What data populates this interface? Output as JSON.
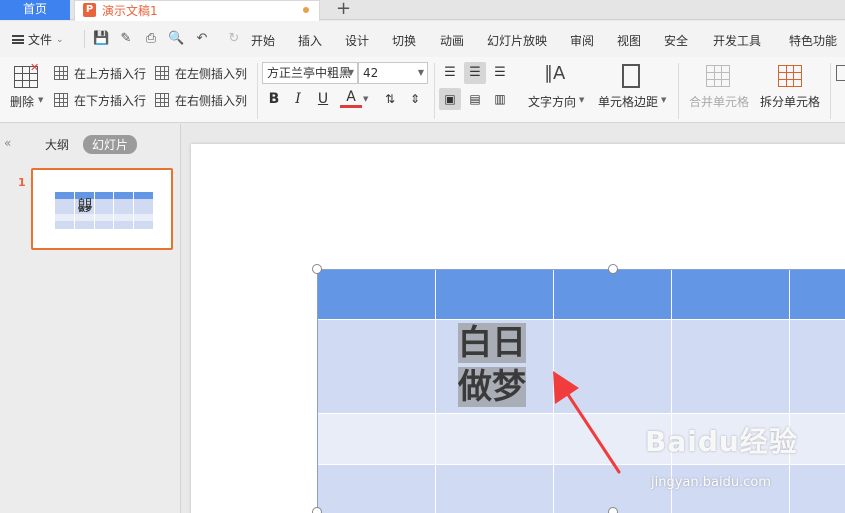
{
  "tabs": {
    "home_label": "首页",
    "doc_title": "演示文稿1",
    "doc_icon": "P",
    "add_label": "+"
  },
  "menu": {
    "file_label": "文件",
    "items": [
      "开始",
      "插入",
      "设计",
      "切换",
      "动画",
      "幻灯片放映",
      "审阅",
      "视图",
      "安全",
      "开发工具",
      "特色功能"
    ]
  },
  "ribbon": {
    "delete_label": "删除",
    "insert_above": "在上方插入行",
    "insert_below": "在下方插入行",
    "insert_left": "在左侧插入列",
    "insert_right": "在右侧插入列",
    "font_name": "方正兰亭中粗黑",
    "font_size": "42",
    "text_direction": "文字方向",
    "cell_margin": "单元格边距",
    "merge_cells": "合并单元格",
    "split_cells": "拆分单元格",
    "bold": "B",
    "italic": "I",
    "underline": "U",
    "font_color": "A"
  },
  "leftpanel": {
    "outline_tab": "大纲",
    "slides_tab": "幻灯片",
    "slide_number": "1",
    "thumb_text": "白日做梦"
  },
  "slide": {
    "cell_text_line1": "白日",
    "cell_text_line2": "做梦"
  },
  "watermark": {
    "brand": "Baidu经验",
    "url": "jingyan.baidu.com"
  },
  "colors": {
    "accent": "#3e82f0",
    "doc_accent": "#e8643c",
    "header_row": "#6496e6",
    "row_dark": "#d0daf2",
    "row_light": "#e8edf8",
    "arrow": "#f03c3c"
  }
}
